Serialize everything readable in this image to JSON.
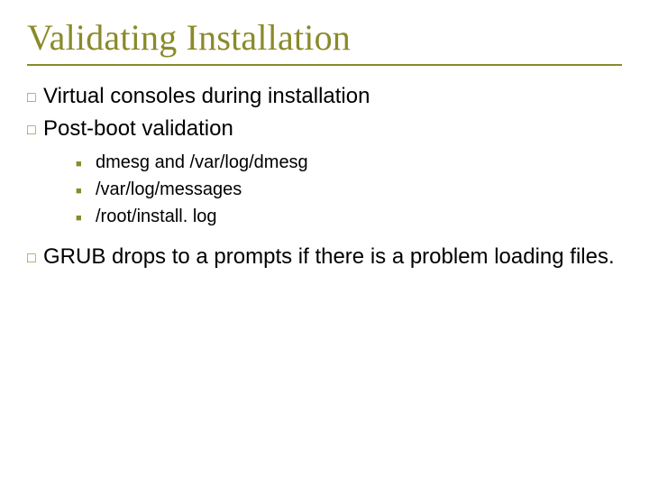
{
  "title": "Validating Installation",
  "bullets": {
    "b1": "Virtual consoles during installation",
    "b2": "Post-boot validation",
    "b2_sub": {
      "s1": "dmesg and /var/log/dmesg",
      "s2": "/var/log/messages",
      "s3": "/root/install. log"
    },
    "b3": "GRUB drops to a prompts if there is a problem loading files."
  },
  "glyphs": {
    "hollow_square": "□",
    "solid_square": "■"
  }
}
